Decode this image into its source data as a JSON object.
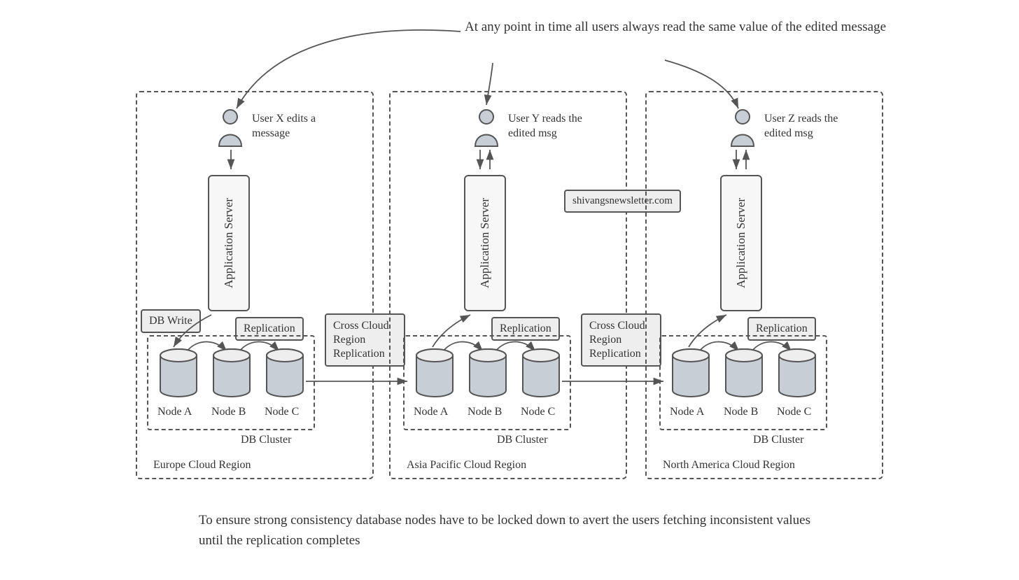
{
  "top_note": "At any point in time all users always read the same value of the edited message",
  "bottom_note": "To ensure strong consistency database nodes have to be locked down to avert the users fetching inconsistent values until the replication completes",
  "watermark": "shivangsnewsletter.com",
  "app_server": "Application Server",
  "users": {
    "x": "User X edits a message",
    "y": "User Y reads the edited msg",
    "z": "User Z reads the edited msg"
  },
  "chips": {
    "db_write": "DB Write",
    "replication": "Replication",
    "cross_repl_line1": "Cross Cloud",
    "cross_repl_line2": "Region",
    "cross_repl_line3": "Replication"
  },
  "nodes": {
    "a": "Node A",
    "b": "Node B",
    "c": "Node C"
  },
  "db_cluster": "DB Cluster",
  "regions": {
    "eu": "Europe Cloud Region",
    "ap": "Asia Pacific Cloud Region",
    "na": "North America Cloud Region"
  },
  "colors": {
    "stroke": "#555555",
    "fill_light": "#eeeeee",
    "fill_cyl": "#c8ced6",
    "fill_user": "#c8ced6"
  }
}
